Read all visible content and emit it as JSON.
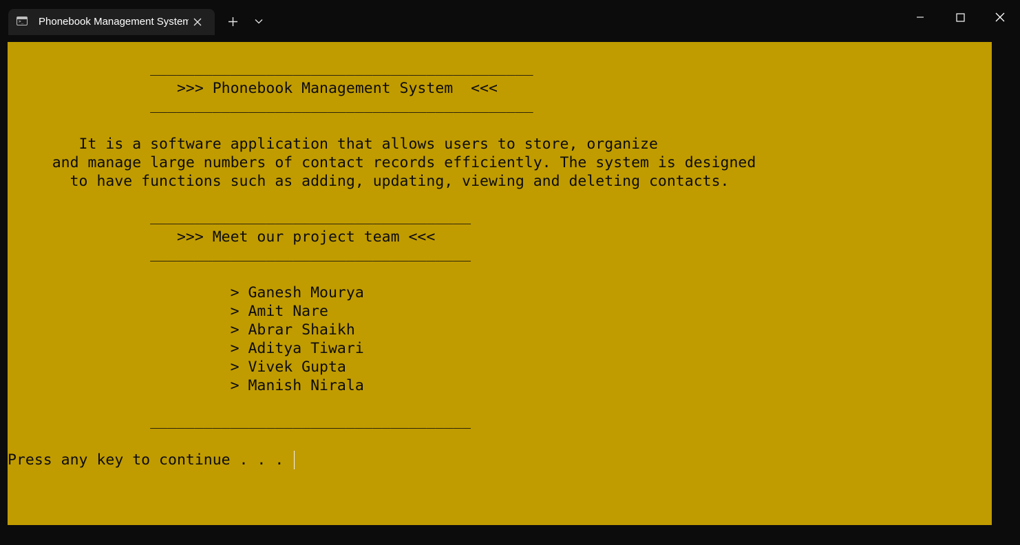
{
  "window": {
    "tab_title": "Phonebook Management System",
    "tab_icon_glyph": ">_",
    "icons": {
      "tab_icon": "terminal-icon",
      "tab_close": "close-icon",
      "new_tab": "plus-icon",
      "dropdown": "chevron-down-icon",
      "minimize": "minimize-icon",
      "maximize": "maximize-icon",
      "close": "close-icon"
    }
  },
  "colors": {
    "terminal_background": "#c19c00",
    "terminal_text": "#0c0c0c",
    "chrome_background": "#0c0c0c",
    "tab_background": "#1f1f1f"
  },
  "terminal": {
    "lines": [
      "                ___________________________________________",
      "                   >>> Phonebook Management System  <<<",
      "                ___________________________________________",
      "",
      "",
      "        It is a software application that allows users to store, organize",
      "     and manage large numbers of contact records efficiently. The system is designed",
      "       to have functions such as adding, updating, viewing and deleting contacts.",
      "",
      "                ____________________________________",
      "                   >>> Meet our project team <<<",
      "                ____________________________________",
      "",
      "",
      "                         > Ganesh Mourya",
      "                         > Amit Nare",
      "                         > Abrar Shaikh",
      "                         > Aditya Tiwari",
      "                         > Vivek Gupta",
      "                         > Manish Nirala",
      "",
      "                ____________________________________",
      "",
      "Press any key to continue . . ."
    ]
  }
}
